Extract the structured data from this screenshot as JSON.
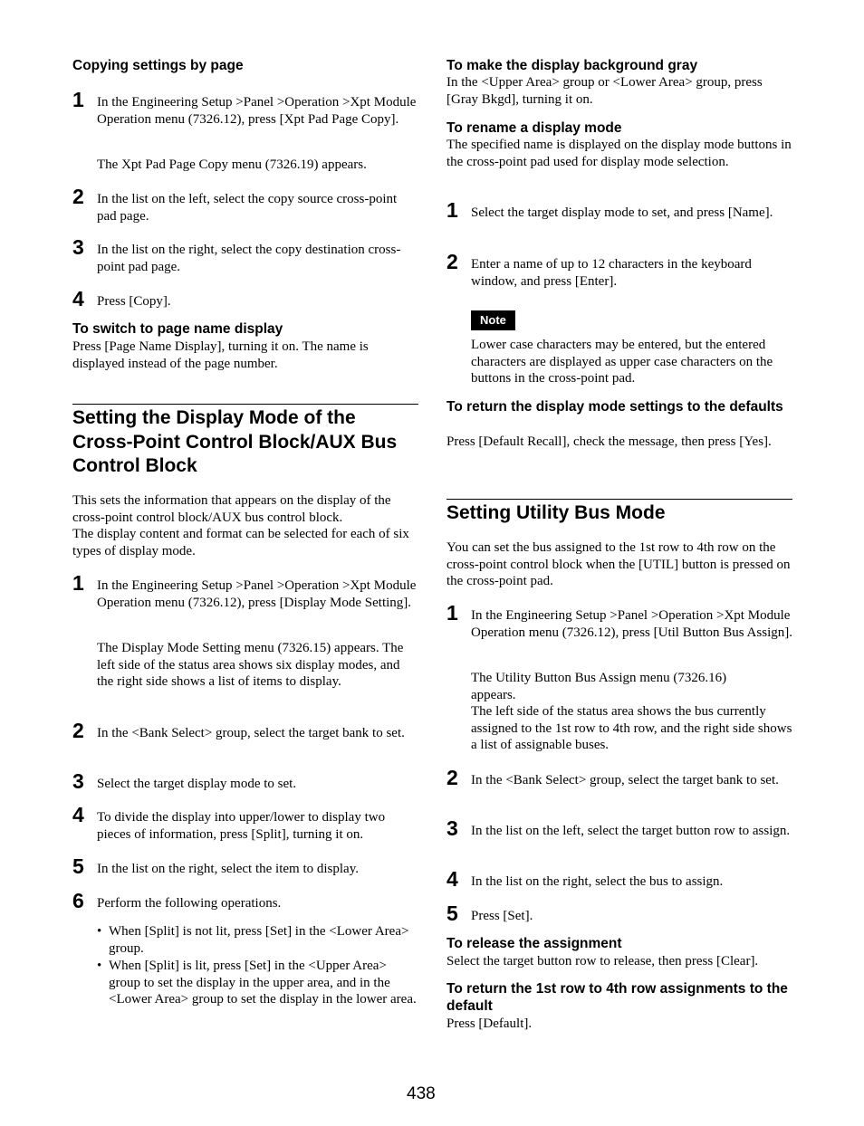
{
  "left": {
    "copying": {
      "heading": "Copying settings by page",
      "steps": [
        {
          "num": "1",
          "text": "In the Engineering Setup >Panel >Operation >Xpt Module Operation menu (7326.12), press [Xpt Pad Page Copy].",
          "sub": "The Xpt Pad Page Copy menu (7326.19) appears."
        },
        {
          "num": "2",
          "text": "In the list on the left, select the copy source cross-point pad page."
        },
        {
          "num": "3",
          "text": "In the list on the right, select the copy destination cross-point pad page."
        },
        {
          "num": "4",
          "text": "Press [Copy]."
        }
      ]
    },
    "page_name": {
      "heading": "To switch to page name display",
      "text": "Press [Page Name Display], turning it on. The name is displayed instead of the page number."
    },
    "display_mode": {
      "heading": "Setting the Display Mode of the Cross-Point Control Block/AUX Bus Control Block",
      "intro1": "This sets the information that appears on the display of the cross-point control block/AUX bus control block.",
      "intro2": "The display content and format can be selected for each of six types of display mode.",
      "steps": [
        {
          "num": "1",
          "text": "In the Engineering Setup >Panel >Operation >Xpt Module Operation menu (7326.12), press [Display Mode Setting].",
          "sub": "The Display Mode Setting menu (7326.15) appears. The left side of the status area shows six display modes, and the right side shows a list of items to display."
        },
        {
          "num": "2",
          "text": "In the <Bank Select> group, select the target bank to set."
        },
        {
          "num": "3",
          "text": "Select the target display mode to set."
        },
        {
          "num": "4",
          "text": "To divide the display into upper/lower to display two pieces of information, press [Split], turning it on."
        },
        {
          "num": "5",
          "text": "In the list on the right, select the item to display."
        },
        {
          "num": "6",
          "text": "Perform the following operations."
        }
      ],
      "bullets": [
        "When [Split] is not lit, press [Set] in the <Lower Area> group.",
        "When [Split] is lit, press [Set] in the <Upper Area> group to set the display in the upper area, and in the <Lower Area> group to set the display in the lower area."
      ]
    }
  },
  "right": {
    "gray_bkgd": {
      "heading": "To make the display background gray",
      "text": "In the <Upper Area> group or <Lower Area> group, press [Gray Bkgd], turning it on."
    },
    "rename": {
      "heading": "To rename a display mode",
      "text": "The specified name is displayed on the display mode buttons in the cross-point pad used for display mode selection.",
      "steps": [
        {
          "num": "1",
          "text": "Select the target display mode to set, and press [Name]."
        },
        {
          "num": "2",
          "text": "Enter a name of up to 12 characters in the keyboard window, and press [Enter]."
        }
      ],
      "note_label": "Note",
      "note_text": "Lower case characters may be entered, but the entered characters are displayed as upper case characters on the buttons in the cross-point pad."
    },
    "defaults": {
      "heading": "To return the display mode settings to the defaults",
      "text": "Press [Default Recall], check the message, then press [Yes]."
    },
    "utility": {
      "heading": "Setting Utility Bus Mode",
      "intro": "You can set the bus assigned to the 1st row to 4th row on the cross-point control block when the [UTIL] button is pressed on the cross-point pad.",
      "steps": [
        {
          "num": "1",
          "text": "In the Engineering Setup >Panel >Operation >Xpt Module Operation menu (7326.12), press [Util Button Bus Assign].",
          "sub1": "The Utility Button Bus Assign menu (7326.16) appears.",
          "sub2": "The left side of the status area shows the bus currently assigned to the 1st row to 4th row, and the right side shows a list of assignable buses."
        },
        {
          "num": "2",
          "text": "In the <Bank Select> group, select the target bank to set."
        },
        {
          "num": "3",
          "text": "In the list on the left, select the target button row to assign."
        },
        {
          "num": "4",
          "text": "In the list on the right, select the bus to assign."
        },
        {
          "num": "5",
          "text": "Press [Set]."
        }
      ]
    },
    "release": {
      "heading": "To release the assignment",
      "text": "Select the target button row to release, then press [Clear]."
    },
    "row_default": {
      "heading": "To return the 1st row to 4th row assignments to the default",
      "text": "Press [Default]."
    }
  },
  "footer": {
    "page_number": "438"
  }
}
